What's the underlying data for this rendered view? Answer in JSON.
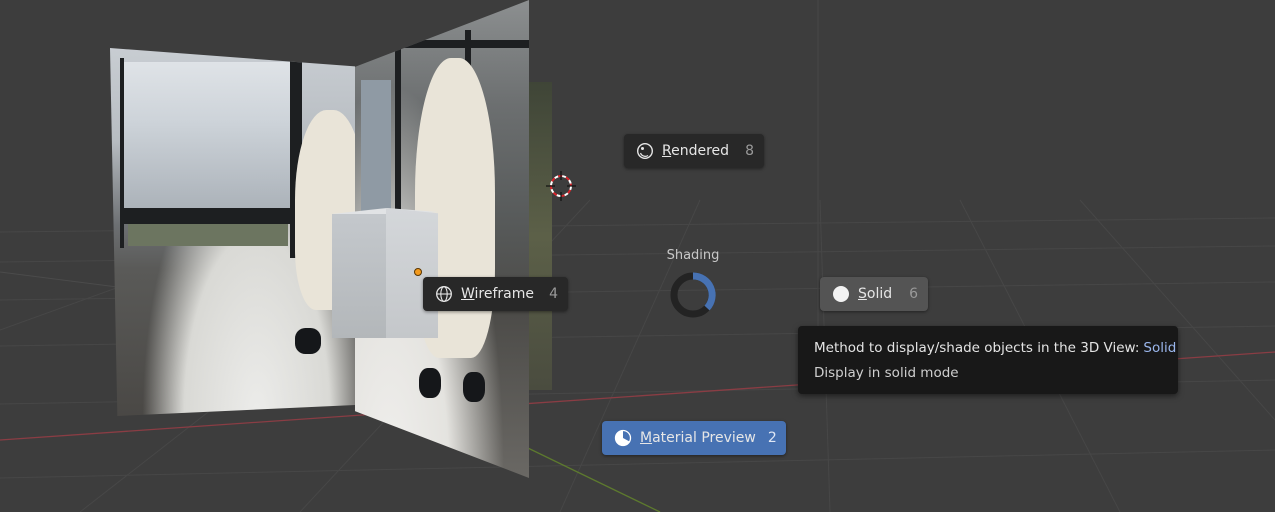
{
  "viewport": {
    "background": "#3d3d3d",
    "grid_color": "#474747",
    "x_axis_color": "#8a3d44",
    "y_axis_color": "#5d7a2e"
  },
  "pie_menu": {
    "title": "Shading",
    "items": {
      "rendered": {
        "label_first": "R",
        "label_rest": "endered",
        "hotkey": "8",
        "icon": "rendered-sphere-icon"
      },
      "wireframe": {
        "label_first": "W",
        "label_rest": "ireframe",
        "hotkey": "4",
        "icon": "wireframe-sphere-icon"
      },
      "solid": {
        "label_first": "S",
        "label_rest": "olid",
        "hotkey": "6",
        "icon": "solid-sphere-icon"
      },
      "material_preview": {
        "label_first": "M",
        "label_rest": "aterial Preview",
        "hotkey": "2",
        "icon": "material-sphere-icon"
      }
    },
    "active_item": "material_preview",
    "hovered_item": "solid",
    "highlight_color": "#4772b3"
  },
  "tooltip": {
    "description": "Method to display/shade objects in the 3D View:",
    "value": "Solid",
    "detail": "Display in solid mode"
  }
}
